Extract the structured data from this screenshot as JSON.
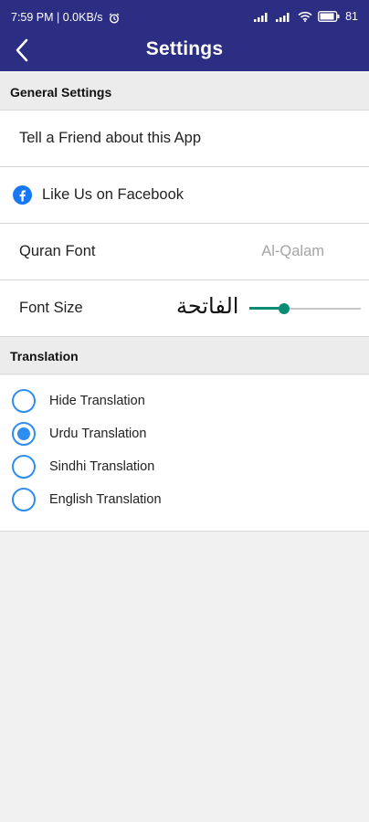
{
  "status_bar": {
    "time_speed": "7:59 PM | 0.0KB/s",
    "battery": "81"
  },
  "header": {
    "title": "Settings"
  },
  "general_settings": {
    "header": "General Settings",
    "tell_friend": "Tell a Friend about this App",
    "facebook": "Like Us on Facebook",
    "quran_font_label": "Quran Font",
    "quran_font_value": "Al-Qalam",
    "font_size_label": "Font Size",
    "font_sample": "الفاتحة",
    "font_size_level": 0.31
  },
  "translation": {
    "header": "Translation",
    "options": [
      {
        "label": "Hide Translation",
        "selected": false
      },
      {
        "label": "Urdu Translation",
        "selected": true
      },
      {
        "label": "Sindhi Translation",
        "selected": false
      },
      {
        "label": "English Translation",
        "selected": false
      }
    ]
  },
  "colors": {
    "appbar": "#2b2e82",
    "radio": "#2f8df0",
    "slider": "#0b8b73",
    "facebook": "#1877f2"
  }
}
